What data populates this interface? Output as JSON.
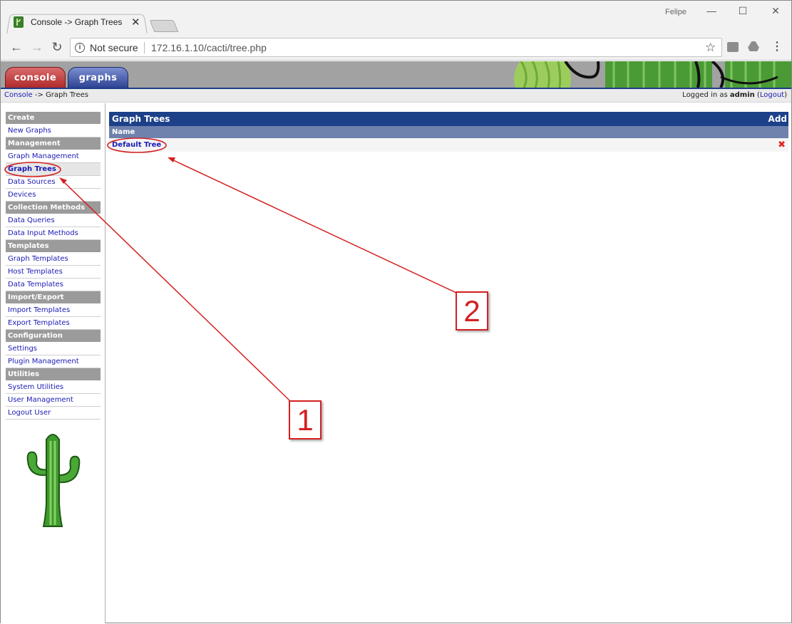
{
  "browser": {
    "tab_title": "Console -> Graph Trees",
    "user_name": "Felipe",
    "security_label": "Not secure",
    "url": "172.16.1.10/cacti/tree.php"
  },
  "header": {
    "console_tab": "console",
    "graphs_tab": "graphs"
  },
  "breadcrumb": {
    "console_link": "Console",
    "separator": " -> ",
    "current": "Graph Trees"
  },
  "login": {
    "prefix": "Logged in as ",
    "user": "admin",
    "logout_open": " (",
    "logout_label": "Logout",
    "logout_close": ")"
  },
  "sidebar": {
    "sections": [
      {
        "title": "Create",
        "items": [
          "New Graphs"
        ]
      },
      {
        "title": "Management",
        "items": [
          "Graph Management",
          "Graph Trees",
          "Data Sources",
          "Devices"
        ]
      },
      {
        "title": "Collection Methods",
        "items": [
          "Data Queries",
          "Data Input Methods"
        ]
      },
      {
        "title": "Templates",
        "items": [
          "Graph Templates",
          "Host Templates",
          "Data Templates"
        ]
      },
      {
        "title": "Import/Export",
        "items": [
          "Import Templates",
          "Export Templates"
        ]
      },
      {
        "title": "Configuration",
        "items": [
          "Settings",
          "Plugin Management"
        ]
      },
      {
        "title": "Utilities",
        "items": [
          "System Utilities",
          "User Management",
          "Logout User"
        ]
      }
    ],
    "active_item": "Graph Trees"
  },
  "main": {
    "title": "Graph Trees",
    "add_label": "Add",
    "column_name": "Name",
    "rows": [
      {
        "name": "Default Tree",
        "delete_icon": "x-icon"
      }
    ]
  },
  "annotations": {
    "label_1": "1",
    "label_2": "2",
    "color": "#d42020"
  },
  "colors": {
    "panel_header": "#1c4189",
    "column_header": "#6f82ad",
    "sidebar_header": "#9b9b9b",
    "link": "#1a1ab5"
  }
}
